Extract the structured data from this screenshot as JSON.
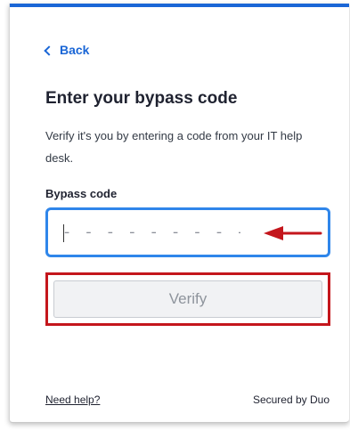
{
  "colors": {
    "accent": "#1a66d6",
    "input_border": "#2f86ea",
    "highlight_red": "#c4161c",
    "button_bg": "#f1f2f4",
    "button_text": "#8e949c"
  },
  "nav": {
    "back_label": "Back",
    "back_icon": "chevron-left-icon"
  },
  "page": {
    "title": "Enter your bypass code",
    "description": "Verify it's you by entering a code from your IT help desk."
  },
  "form": {
    "field_label": "Bypass code",
    "input_value": "",
    "input_placeholder": "- - - - - - - - -",
    "annotation_icon": "arrow-left-icon",
    "verify_label": "Verify",
    "verify_disabled": true
  },
  "footer": {
    "help_link": "Need help?",
    "secured_text": "Secured by Duo"
  }
}
